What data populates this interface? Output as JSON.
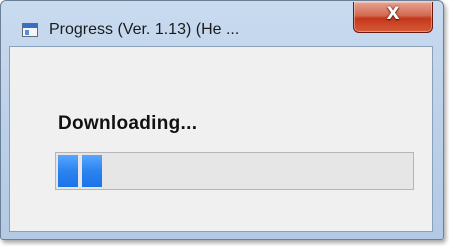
{
  "window": {
    "title": "Progress  (Ver. 1.13) (He ...",
    "close_symbol": "X"
  },
  "content": {
    "status_label": "Downloading...",
    "progress": {
      "visible_chunks": 2,
      "chunk_color": "#2a83f0",
      "track_color": "#e6e6e6"
    }
  },
  "icons": {
    "app": "window-app-icon",
    "close": "close-icon"
  }
}
